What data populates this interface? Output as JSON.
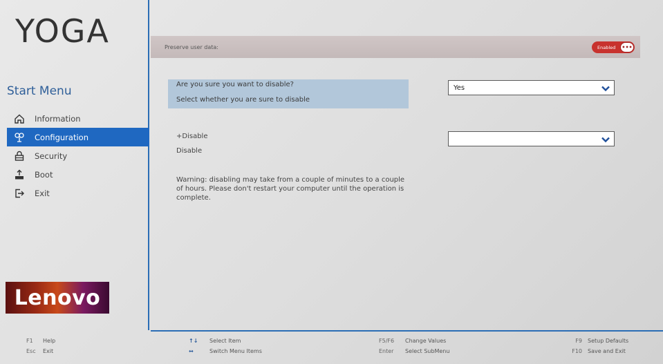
{
  "sidebar": {
    "logo": "YOGA",
    "start_menu": "Start Menu",
    "items": [
      {
        "label": "Information"
      },
      {
        "label": "Configuration"
      },
      {
        "label": "Security"
      },
      {
        "label": "Boot"
      },
      {
        "label": "Exit"
      }
    ],
    "brand": "Lenovo"
  },
  "main": {
    "top_label": "Preserve user data:",
    "toggle_label": "Enabled",
    "toggle_knob": "•••",
    "question": "Are you sure you want to disable?",
    "question_help": "Select whether you are sure to disable",
    "question_value": "Yes",
    "item_label": "+Disable",
    "item_sub": "Disable",
    "item_value": "",
    "warning": "Warning: disabling may take from a couple of minutes to a couple of hours. Please don't restart your computer until the operation is complete."
  },
  "footer": {
    "f1_key": "F1",
    "f1_label": "Help",
    "esc_key": "Esc",
    "esc_label": "Exit",
    "updown_key": "↑↓",
    "updown_label": "Select Item",
    "leftright_key": "↔",
    "leftright_label": "Switch Menu Items",
    "f5f6_key": "F5/F6",
    "f5f6_label": "Change Values",
    "enter_key": "Enter",
    "enter_label": "Select SubMenu",
    "f9_key": "F9",
    "f9_label": "Setup Defaults",
    "f10_key": "F10",
    "f10_label": "Save and Exit"
  },
  "colors": {
    "accent": "#1f68c1",
    "highlight": "#b2c7da",
    "toggle": "#c8322e"
  }
}
